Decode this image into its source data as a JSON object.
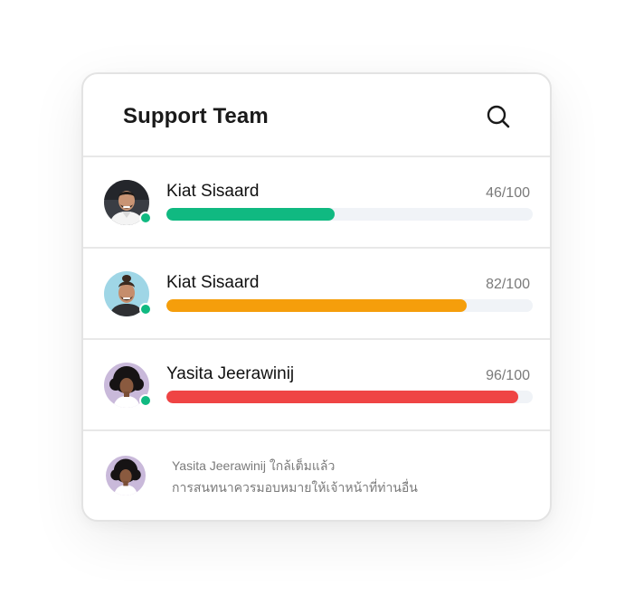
{
  "header": {
    "title": "Support Team",
    "search_icon": "search-icon"
  },
  "agents": [
    {
      "name": "Kiat Sisaard",
      "score": "46/100",
      "progress": 0.46,
      "color": "#10b981",
      "online": true
    },
    {
      "name": "Kiat Sisaard",
      "score": "82/100",
      "progress": 0.82,
      "color": "#f59e0b",
      "online": true
    },
    {
      "name": "Yasita Jeerawinij",
      "score": "96/100",
      "progress": 0.96,
      "color": "#ef4444",
      "online": true
    }
  ],
  "notice": {
    "line1": "Yasita Jeerawinij  ใกล้เต็มแล้ว",
    "line2": "การสนทนาควรมอบหมายให้เจ้าหน้าที่ท่านอื่น"
  },
  "colors": {
    "online": "#10b981",
    "track": "#f0f3f7"
  }
}
